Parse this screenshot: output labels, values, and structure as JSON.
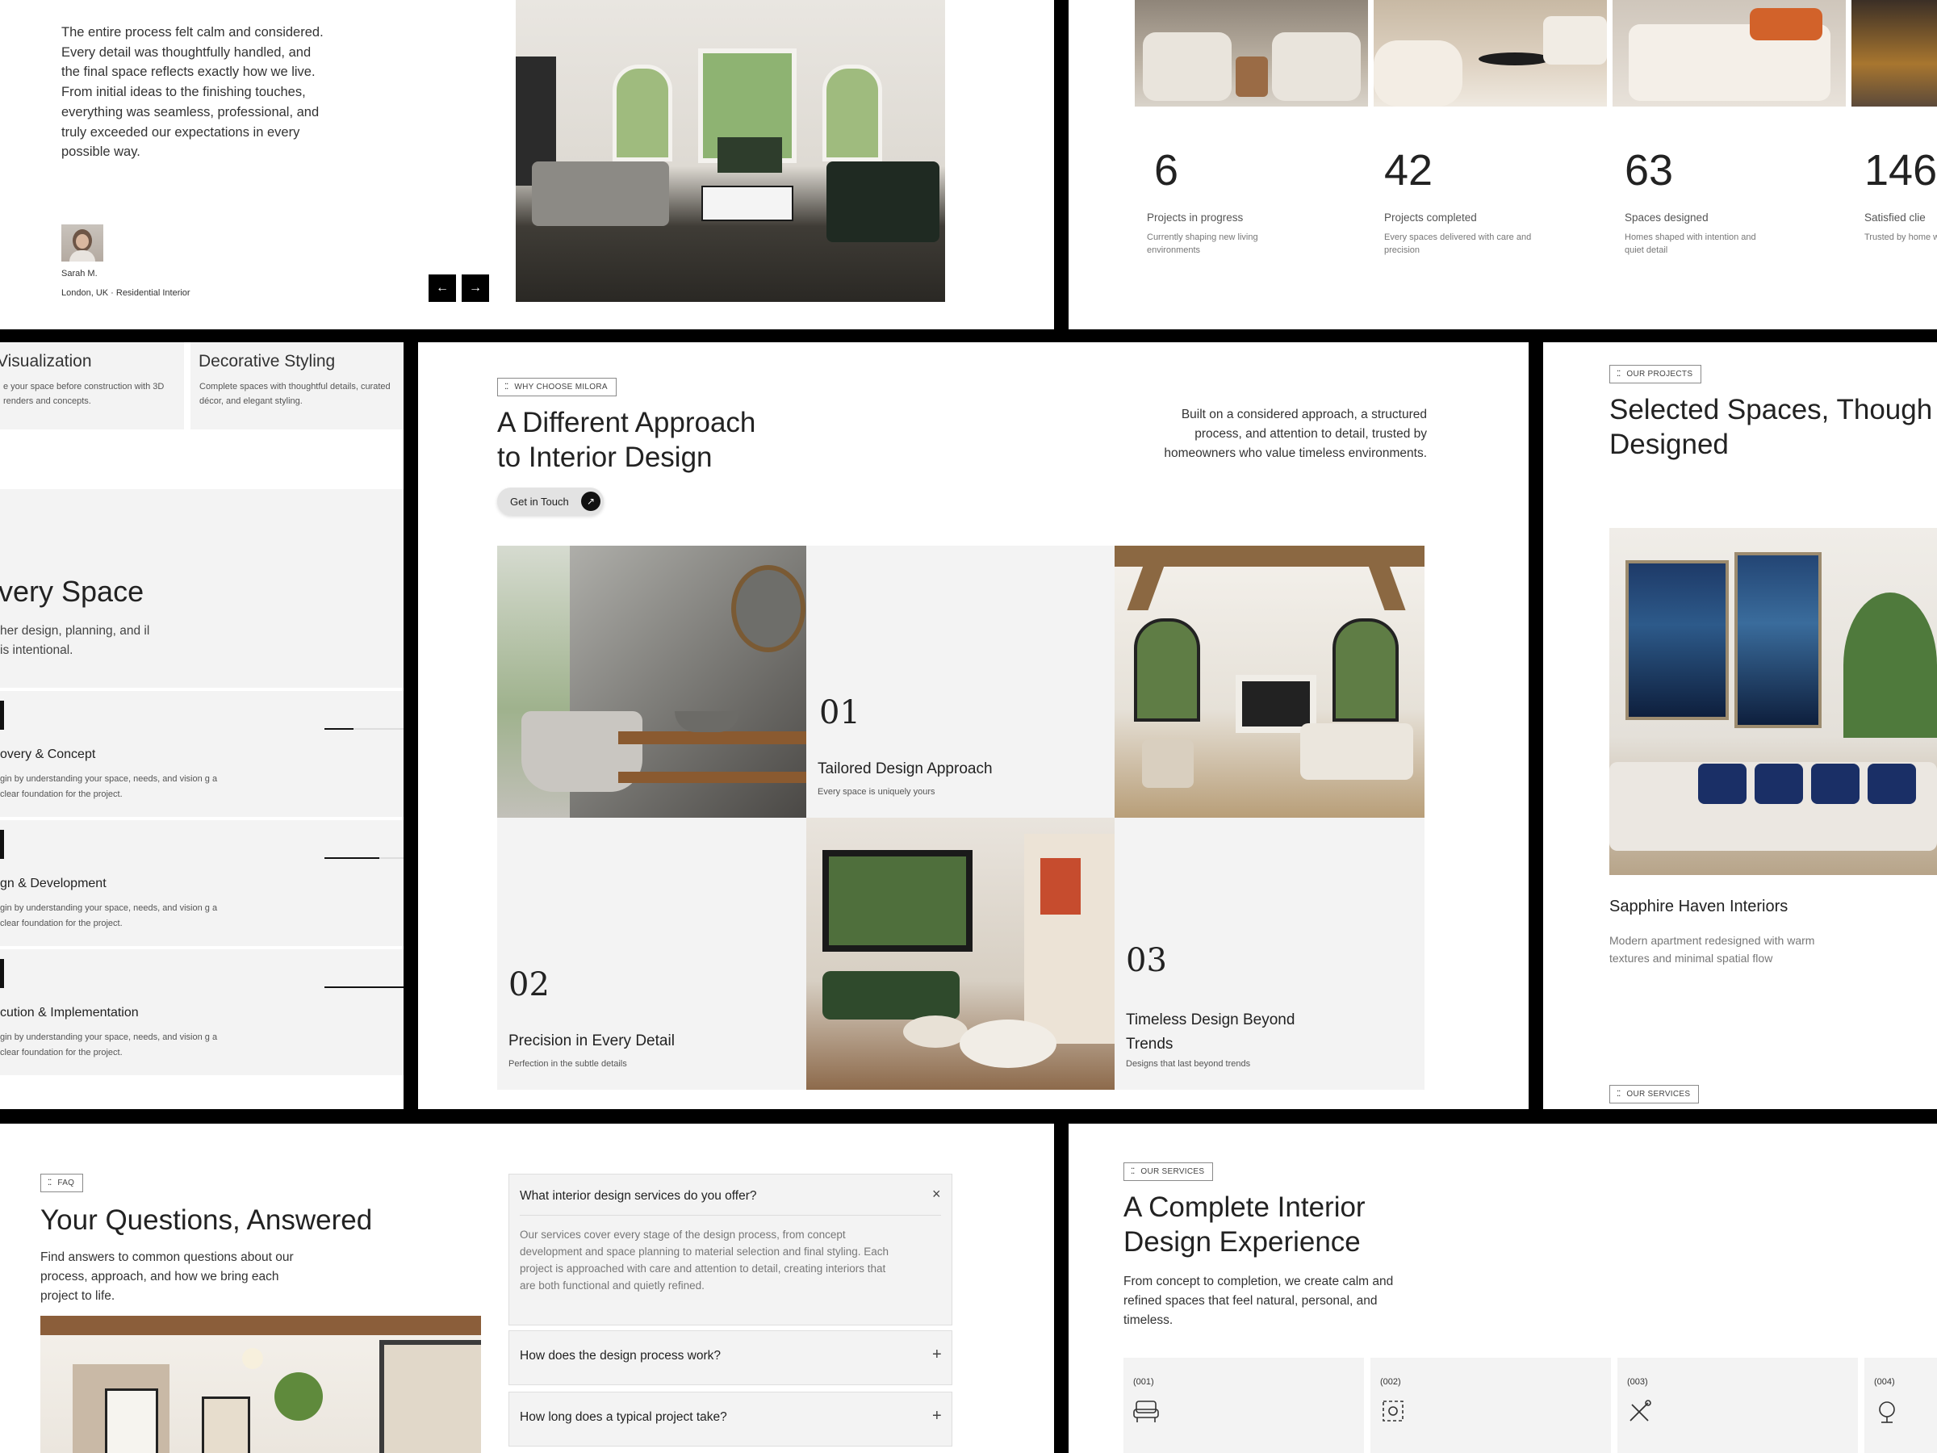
{
  "testimonial": {
    "quote": "The entire process felt calm and considered. Every detail was thoughtfully handled, and the final space reflects exactly how we live. From initial ideas to the finishing touches, everything was seamless, professional, and truly exceeded our expectations in every possible way.",
    "name": "Sarah M.",
    "location": "London, UK · Residential Interior",
    "prev_icon": "←",
    "next_icon": "→"
  },
  "stats": {
    "items": [
      {
        "number": "6",
        "label": "Projects in progress",
        "desc": "Currently shaping new living environments"
      },
      {
        "number": "42",
        "label": "Projects completed",
        "desc": "Every spaces delivered with care and precision"
      },
      {
        "number": "63",
        "label": "Spaces designed",
        "desc": "Homes shaped with intention and quiet detail"
      },
      {
        "number": "146",
        "label": "Satisfied clie",
        "desc": "Trusted by home who value thoug"
      }
    ]
  },
  "process": {
    "service_cards": [
      {
        "title": "Visualization",
        "desc": "e your space before construction with 3D renders and concepts."
      },
      {
        "title": "Decorative Styling",
        "desc": "Complete spaces with thoughtful details, curated décor, and elegant styling."
      }
    ],
    "heading": "very Space",
    "subtext": "her design, planning, and il is intentional.",
    "steps": [
      {
        "title": "overy & Concept",
        "desc": "gin by understanding your space, needs, and vision g a clear foundation for the project."
      },
      {
        "title": "gn & Development",
        "desc": "gin by understanding your space, needs, and vision g a clear foundation for the project."
      },
      {
        "title": "cution & Implementation",
        "desc": "gin by understanding your space, needs, and vision g a clear foundation for the project."
      }
    ]
  },
  "why": {
    "tag": "WHY CHOOSE MILORA",
    "title_line1": "A Different Approach",
    "title_line2": "to Interior Design",
    "cta": "Get in Touch",
    "cta_icon": "↗",
    "intro": "Built on a considered approach, a structured process, and attention to detail, trusted by homeowners who value timeless environments.",
    "features": [
      {
        "num": "01",
        "title": "Tailored Design Approach",
        "sub": "Every space is uniquely yours"
      },
      {
        "num": "02",
        "title": "Precision in Every Detail",
        "sub": "Perfection in the subtle details"
      },
      {
        "num": "03",
        "title": "Timeless Design Beyond Trends",
        "sub": "Designs that last beyond trends"
      }
    ]
  },
  "projects": {
    "tag": "OUR PROJECTS",
    "title": "Selected Spaces, Though Designed",
    "project_name": "Sapphire Haven Interiors",
    "project_desc": "Modern apartment redesigned with warm textures and minimal spatial flow",
    "services_tag": "OUR SERVICES"
  },
  "faq": {
    "tag": "FAQ",
    "title": "Your Questions, Answered",
    "intro": "Find answers to common questions about our process, approach, and how we bring each project to life.",
    "items": [
      {
        "q": "What interior design services do you offer?",
        "a": "Our services cover every stage of the design process, from concept development and space planning to material selection and final styling. Each project is approached with care and attention to detail, creating interiors that are both functional and quietly refined.",
        "icon": "×"
      },
      {
        "q": "How does the design process work?",
        "icon": "+"
      },
      {
        "q": "How long does a typical project take?",
        "icon": "+"
      }
    ]
  },
  "services": {
    "tag": "OUR SERVICES",
    "title_line1": "A Complete Interior",
    "title_line2": "Design Experience",
    "intro": "From concept to completion, we create calm and refined spaces that feel natural, personal, and timeless.",
    "cards": [
      {
        "num": "(001)"
      },
      {
        "num": "(002)"
      },
      {
        "num": "(003)"
      },
      {
        "num": "(004)"
      }
    ]
  }
}
